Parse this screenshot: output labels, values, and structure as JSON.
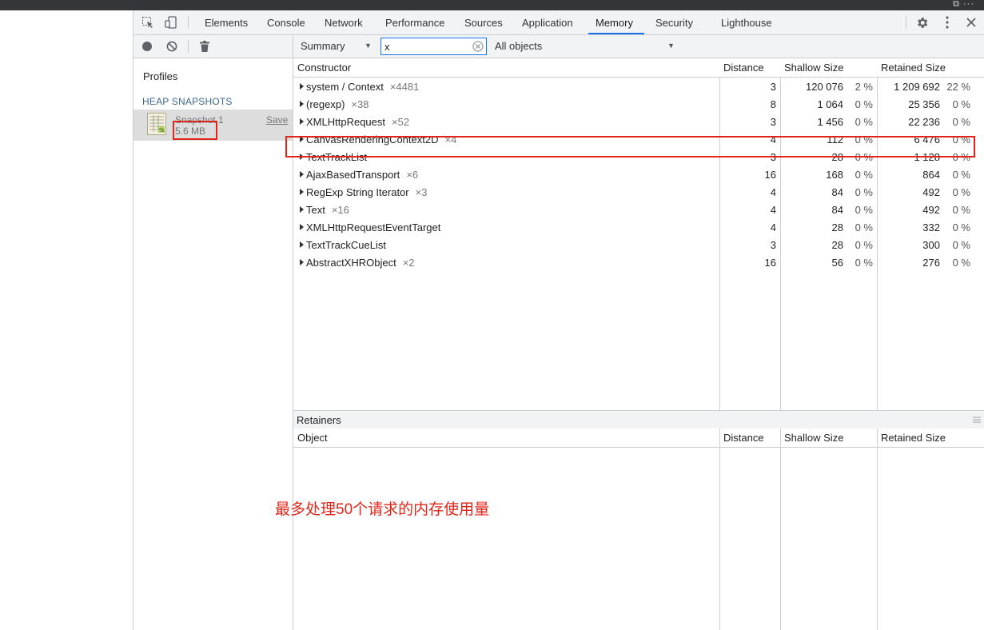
{
  "topbar": {
    "corner_text": "⧉ ···"
  },
  "devtools": {
    "tabs": [
      {
        "label": "Elements"
      },
      {
        "label": "Console"
      },
      {
        "label": "Network"
      },
      {
        "label": "Performance"
      },
      {
        "label": "Sources"
      },
      {
        "label": "Application"
      },
      {
        "label": "Memory",
        "active": true
      },
      {
        "label": "Security"
      },
      {
        "label": "Lighthouse"
      }
    ],
    "icons": {
      "inspect": "inspect-element-icon",
      "device": "device-toolbar-icon",
      "settings": "gear-icon",
      "more": "kebab-menu-icon",
      "close": "close-icon"
    }
  },
  "left_panel": {
    "toolbar_icons": [
      "record-icon",
      "clear-all-icon",
      "trash-icon"
    ],
    "profiles_label": "Profiles",
    "heap_snapshots_title": "HEAP SNAPSHOTS",
    "snapshot": {
      "name": "Snapshot 1",
      "size": "5.6 MB",
      "save_label": "Save"
    }
  },
  "toolbar": {
    "view": "Summary",
    "filter_value": "x",
    "class_filter": "All objects"
  },
  "table": {
    "columns": [
      "Constructor",
      "Distance",
      "Shallow Size",
      "Retained Size"
    ],
    "rows": [
      {
        "name": "system / Context",
        "count": "×4481",
        "distance": "3",
        "shallow": "120 076",
        "shallow_pct": "2 %",
        "retained": "1 209 692",
        "retained_pct": "22 %"
      },
      {
        "name": "(regexp)",
        "count": "×38",
        "distance": "8",
        "shallow": "1 064",
        "shallow_pct": "0 %",
        "retained": "25 356",
        "retained_pct": "0 %"
      },
      {
        "name": "XMLHttpRequest",
        "count": "×52",
        "distance": "3",
        "shallow": "1 456",
        "shallow_pct": "0 %",
        "retained": "22 236",
        "retained_pct": "0 %"
      },
      {
        "name": "CanvasRenderingContext2D",
        "count": "×4",
        "distance": "4",
        "shallow": "112",
        "shallow_pct": "0 %",
        "retained": "6 476",
        "retained_pct": "0 %"
      },
      {
        "name": "TextTrackList",
        "count": "",
        "distance": "3",
        "shallow": "28",
        "shallow_pct": "0 %",
        "retained": "1 128",
        "retained_pct": "0 %"
      },
      {
        "name": "AjaxBasedTransport",
        "count": "×6",
        "distance": "16",
        "shallow": "168",
        "shallow_pct": "0 %",
        "retained": "864",
        "retained_pct": "0 %"
      },
      {
        "name": "RegExp String Iterator",
        "count": "×3",
        "distance": "4",
        "shallow": "84",
        "shallow_pct": "0 %",
        "retained": "492",
        "retained_pct": "0 %"
      },
      {
        "name": "Text",
        "count": "×16",
        "distance": "4",
        "shallow": "84",
        "shallow_pct": "0 %",
        "retained": "492",
        "retained_pct": "0 %"
      },
      {
        "name": "XMLHttpRequestEventTarget",
        "count": "",
        "distance": "4",
        "shallow": "28",
        "shallow_pct": "0 %",
        "retained": "332",
        "retained_pct": "0 %"
      },
      {
        "name": "TextTrackCueList",
        "count": "",
        "distance": "3",
        "shallow": "28",
        "shallow_pct": "0 %",
        "retained": "300",
        "retained_pct": "0 %"
      },
      {
        "name": "AbstractXHRObject",
        "count": "×2",
        "distance": "16",
        "shallow": "56",
        "shallow_pct": "0 %",
        "retained": "276",
        "retained_pct": "0 %"
      }
    ]
  },
  "retainers": {
    "title": "Retainers",
    "columns": [
      "Object",
      "Distance",
      "Shallow Size",
      "Retained Size"
    ]
  },
  "annotation": {
    "text": "最多处理50个请求的内存使用量",
    "color": "#e0261a"
  },
  "colors": {
    "accent": "#1a73e8",
    "highlight": "#e0261a"
  }
}
